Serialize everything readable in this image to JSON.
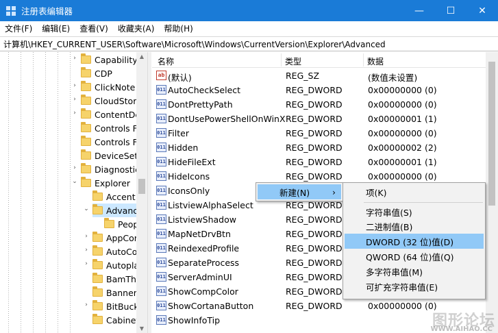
{
  "window": {
    "title": "注册表编辑器",
    "minimize": "—",
    "maximize": "☐",
    "close": "✕"
  },
  "menu": [
    "文件(F)",
    "编辑(E)",
    "查看(V)",
    "收藏夹(A)",
    "帮助(H)"
  ],
  "address": "计算机\\HKEY_CURRENT_USER\\Software\\Microsoft\\Windows\\CurrentVersion\\Explorer\\Advanced",
  "tree": {
    "items": [
      {
        "label": "Capability",
        "level": 1,
        "expander": "›"
      },
      {
        "label": "CDP",
        "level": 1,
        "expander": ""
      },
      {
        "label": "ClickNote",
        "level": 1,
        "expander": "›"
      },
      {
        "label": "CloudStor",
        "level": 1,
        "expander": "›"
      },
      {
        "label": "ContentDe",
        "level": 1,
        "expander": "›"
      },
      {
        "label": "Controls F",
        "level": 1,
        "expander": ""
      },
      {
        "label": "Controls F",
        "level": 1,
        "expander": ""
      },
      {
        "label": "DeviceSetu",
        "level": 1,
        "expander": ""
      },
      {
        "label": "Diagnostic",
        "level": 1,
        "expander": "›"
      },
      {
        "label": "Explorer",
        "level": 1,
        "expander": "⌄"
      },
      {
        "label": "Accent",
        "level": 2,
        "expander": ""
      },
      {
        "label": "Advance",
        "level": 2,
        "expander": "⌄",
        "selected": true
      },
      {
        "label": "Peop",
        "level": 3,
        "expander": ""
      },
      {
        "label": "AppCor",
        "level": 2,
        "expander": "›"
      },
      {
        "label": "AutoCo",
        "level": 2,
        "expander": "›"
      },
      {
        "label": "Autopla",
        "level": 2,
        "expander": "›"
      },
      {
        "label": "BamThr",
        "level": 2,
        "expander": ""
      },
      {
        "label": "BannerS",
        "level": 2,
        "expander": ""
      },
      {
        "label": "BitBuck",
        "level": 2,
        "expander": "›"
      },
      {
        "label": "Cabinet",
        "level": 2,
        "expander": ""
      }
    ]
  },
  "list": {
    "headers": [
      "名称",
      "类型",
      "数据"
    ],
    "rows": [
      {
        "name": "(默认)",
        "type": "REG_SZ",
        "data": "(数值未设置)",
        "icon": "ab"
      },
      {
        "name": "AutoCheckSelect",
        "type": "REG_DWORD",
        "data": "0x00000000 (0)",
        "icon": "011"
      },
      {
        "name": "DontPrettyPath",
        "type": "REG_DWORD",
        "data": "0x00000000 (0)",
        "icon": "011"
      },
      {
        "name": "DontUsePowerShellOnWinX",
        "type": "REG_DWORD",
        "data": "0x00000001 (1)",
        "icon": "011"
      },
      {
        "name": "Filter",
        "type": "REG_DWORD",
        "data": "0x00000000 (0)",
        "icon": "011"
      },
      {
        "name": "Hidden",
        "type": "REG_DWORD",
        "data": "0x00000002 (2)",
        "icon": "011"
      },
      {
        "name": "HideFileExt",
        "type": "REG_DWORD",
        "data": "0x00000001 (1)",
        "icon": "011"
      },
      {
        "name": "HideIcons",
        "type": "REG_DWORD",
        "data": "0x00000000 (0)",
        "icon": "011"
      },
      {
        "name": "IconsOnly",
        "type": "",
        "data": "",
        "icon": "011"
      },
      {
        "name": "ListviewAlphaSelect",
        "type": "REG_DWORD",
        "data": "",
        "icon": "011"
      },
      {
        "name": "ListviewShadow",
        "type": "REG_DWORD",
        "data": "",
        "icon": "011"
      },
      {
        "name": "MapNetDrvBtn",
        "type": "REG_DWORD",
        "data": "",
        "icon": "011"
      },
      {
        "name": "ReindexedProfile",
        "type": "REG_DWORD",
        "data": "",
        "icon": "011"
      },
      {
        "name": "SeparateProcess",
        "type": "REG_DWORD",
        "data": "",
        "icon": "011"
      },
      {
        "name": "ServerAdminUI",
        "type": "REG_DWORD",
        "data": "",
        "icon": "011"
      },
      {
        "name": "ShowCompColor",
        "type": "REG_DWORD",
        "data": "",
        "icon": "011"
      },
      {
        "name": "ShowCortanaButton",
        "type": "REG_DWORD",
        "data": "0x00000000 (0)",
        "icon": "011"
      },
      {
        "name": "ShowInfoTip",
        "type": "",
        "data": "",
        "icon": "011"
      }
    ]
  },
  "context_menu": {
    "new_label": "新建(N)",
    "arrow": "›"
  },
  "submenu": {
    "items": [
      "项(K)",
      "字符串值(S)",
      "二进制值(B)",
      "DWORD (32 位)值(D)",
      "QWORD (64 位)值(Q)",
      "多字符串值(M)",
      "可扩充字符串值(E)"
    ],
    "highlighted_index": 3
  },
  "watermark": {
    "text": "图形论坛",
    "sub": "WWW.AIHAO.CC"
  },
  "colors": {
    "titlebar": "#1a7bd7",
    "highlight": "#91c9f7",
    "selection": "#cce8ff"
  }
}
